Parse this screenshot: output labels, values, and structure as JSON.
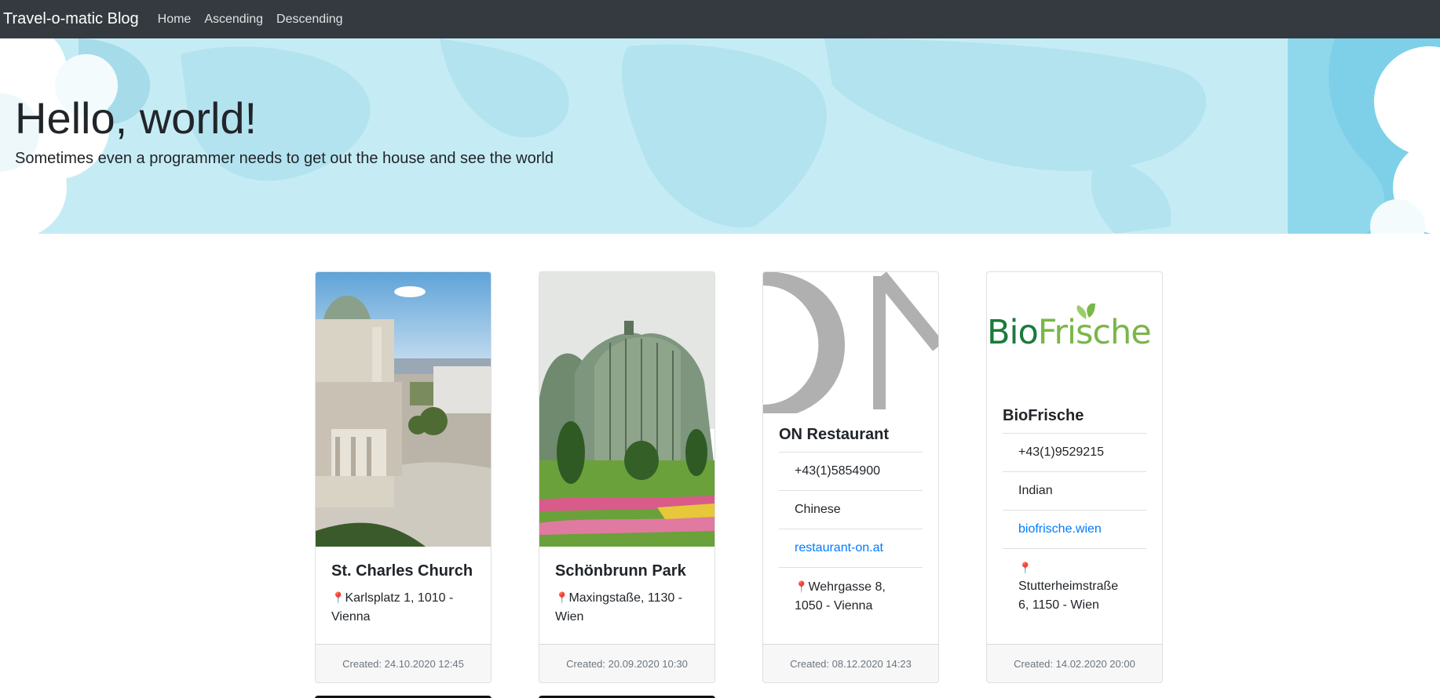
{
  "navbar": {
    "brand": "Travel-o-matic Blog",
    "links": [
      "Home",
      "Ascending",
      "Descending"
    ]
  },
  "hero": {
    "title": "Hello, world!",
    "subtitle": "Sometimes even a programmer needs to get out the house and see the world"
  },
  "cards": [
    {
      "title": "St. Charles Church",
      "pin": "📍",
      "address": "Karlsplatz 1, 1010 - Vienna",
      "created": "Created: 24.10.2020 12:45"
    },
    {
      "title": "Schönbrunn Park",
      "pin": "📍",
      "address": "Maxingstaße, 1130 - Wien",
      "created": "Created: 20.09.2020 10:30"
    },
    {
      "title": "ON Restaurant",
      "phone": "+43(1)5854900",
      "cuisine": "Chinese",
      "website": "restaurant-on.at",
      "pin": "📍",
      "address": "Wehrgasse 8, 1050 - Vienna",
      "created": "Created: 08.12.2020 14:23"
    },
    {
      "title": "BioFrische",
      "logo_text_a": "Bio",
      "logo_text_b": "Frische",
      "phone": "+43(1)9529215",
      "cuisine": "Indian",
      "website": "biofrische.wien",
      "pin": "📍",
      "address": "Stutterheimstraße 6, 1150 - Wien",
      "created": "Created: 14.02.2020 20:00"
    }
  ],
  "colors": {
    "navbar_bg": "#343a40",
    "hero_bg": "#c5ecf5",
    "link": "#007bff",
    "biofrische_dark": "#1a7a3c",
    "biofrische_light": "#7ab648"
  }
}
